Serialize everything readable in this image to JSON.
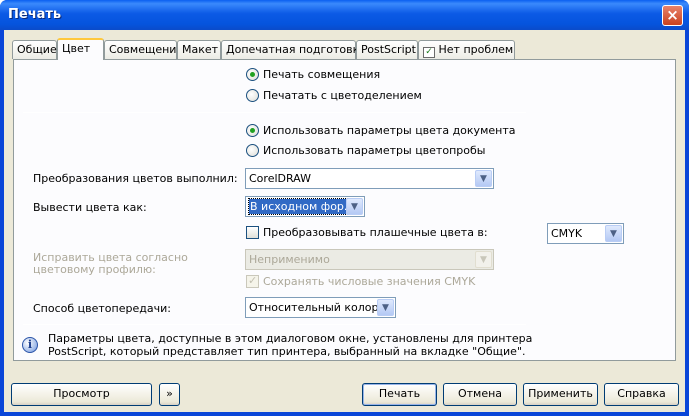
{
  "window": {
    "title": "Печать"
  },
  "tabs": [
    "Общие",
    "Цвет",
    "Совмещение",
    "Макет",
    "Допечатная подготовка",
    "PostScript",
    "Нет проблем"
  ],
  "output_mode": {
    "composite": "Печать совмещения",
    "separations": "Печатать с цветоделением",
    "selected": "composite"
  },
  "color_source": {
    "document": "Использовать параметры цвета документа",
    "proof": "Использовать параметры цветопробы",
    "selected": "document"
  },
  "conversion": {
    "label": "Преобразования цветов выполнил:",
    "value": "CorelDRAW"
  },
  "output_as": {
    "label": "Вывести цвета как:",
    "value": "В исходном фор..."
  },
  "spot": {
    "label": "Преобразовывать плашечные цвета в:",
    "checked": false,
    "value": "CMYK"
  },
  "profile": {
    "label_line1": "Исправить цвета согласно",
    "label_line2": "цветовому профилю:",
    "value": "Неприменимо"
  },
  "preserve_cmyk": {
    "label": "Сохранять числовые значения CMYK",
    "checked": true
  },
  "rendering": {
    "label": "Способ цветопередачи:",
    "value": "Относительный колор..."
  },
  "info": {
    "line1": "Параметры цвета, доступные в этом диалоговом окне, установлены для принтера",
    "line2": "PostScript, который представляет тип принтера, выбранный на вкладке \"Общие\"."
  },
  "buttons": {
    "preview": "Просмотр",
    "expand": "»",
    "print": "Печать",
    "cancel": "Отмена",
    "apply": "Применить",
    "help": "Справка"
  },
  "colors": {
    "titlebar": "#0a5ae6",
    "face": "#ece9d8",
    "selection": "#316ac5",
    "active_tab_accent": "#ffc83c"
  }
}
